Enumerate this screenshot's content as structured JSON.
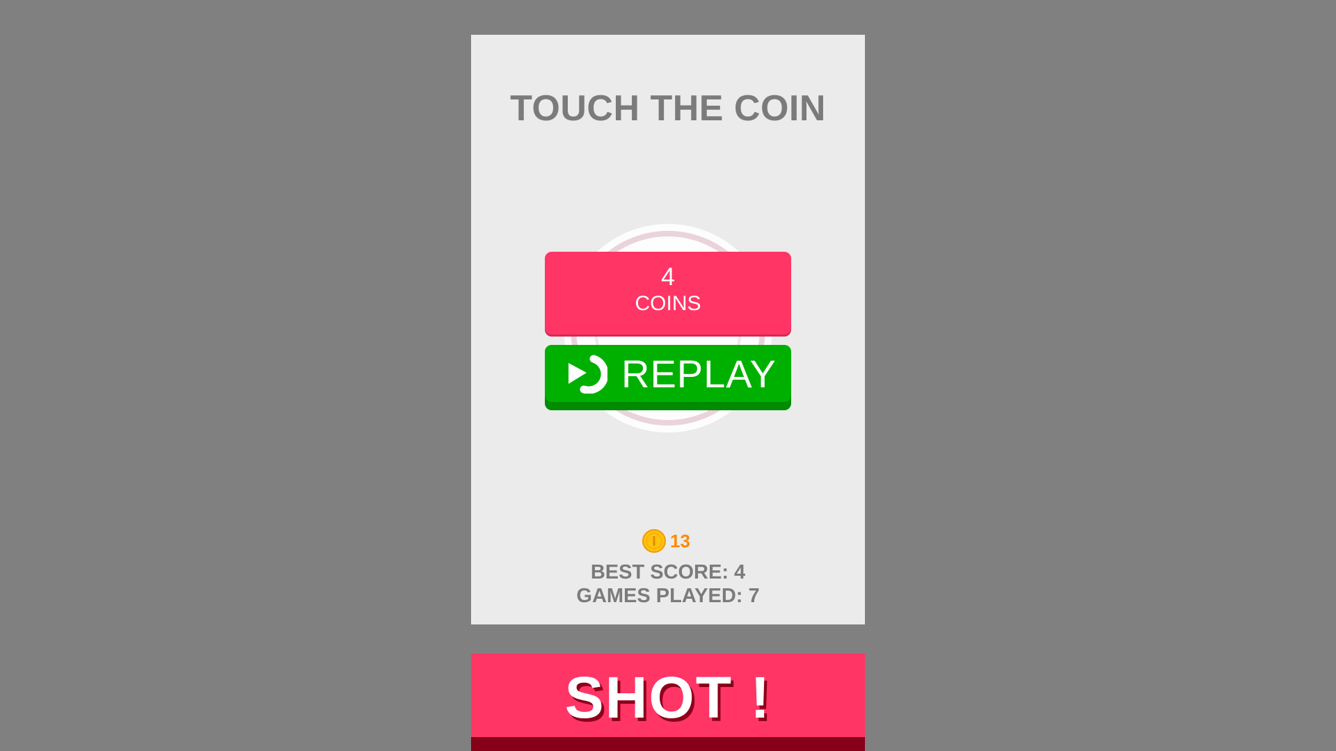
{
  "title": "TOUCH THE COIN",
  "result": {
    "score": "4",
    "unit": "COINS"
  },
  "replay_button": {
    "label": "REPLAY",
    "icon": "replay-icon"
  },
  "coin_counter": {
    "icon": "coin-icon",
    "total": "13"
  },
  "stats": {
    "best_score": "BEST SCORE: 4",
    "games_played": "GAMES PLAYED: 7"
  },
  "shot_button": {
    "label": "SHOT !"
  },
  "colors": {
    "background": "#808080",
    "panel": "#ebebeb",
    "accent_pink": "#ff3566",
    "replay_green": "#00b000",
    "coin_gold": "#ffc20e",
    "coin_text_orange": "#ff8a00",
    "text_gray": "#7b7b7b"
  }
}
